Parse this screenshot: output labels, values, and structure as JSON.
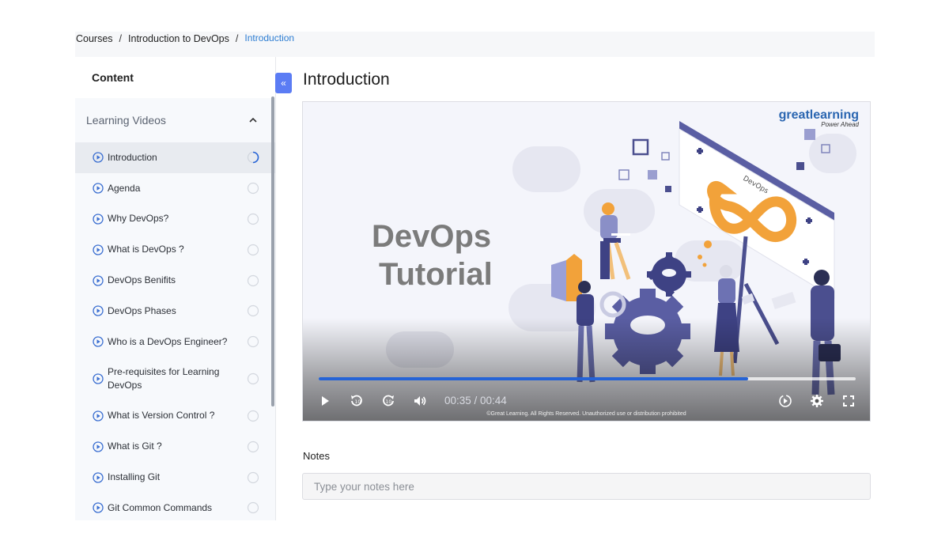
{
  "breadcrumb": {
    "items": [
      "Courses",
      "Introduction to DevOps"
    ],
    "separator": "/",
    "current": "Introduction"
  },
  "sidebar": {
    "title": "Content",
    "collapse_label": "«",
    "section": {
      "label": "Learning Videos",
      "expanded": true
    },
    "items": [
      {
        "label": "Introduction",
        "active": true,
        "status": "in-progress"
      },
      {
        "label": "Agenda",
        "status": "not-started"
      },
      {
        "label": "Why DevOps?",
        "status": "not-started"
      },
      {
        "label": "What is DevOps ?",
        "status": "not-started"
      },
      {
        "label": "DevOps Benifits",
        "status": "not-started"
      },
      {
        "label": "DevOps Phases",
        "status": "not-started"
      },
      {
        "label": "Who is a DevOps Engineer?",
        "status": "not-started"
      },
      {
        "label": "Pre-requisites for Learning DevOps",
        "status": "not-started"
      },
      {
        "label": "What is Version Control ?",
        "status": "not-started"
      },
      {
        "label": "What is Git ?",
        "status": "not-started"
      },
      {
        "label": "Installing Git",
        "status": "not-started"
      },
      {
        "label": "Git Common Commands",
        "status": "not-started"
      }
    ]
  },
  "main": {
    "title": "Introduction",
    "video": {
      "slide_line1": "DevOps",
      "slide_line2": "Tutorial",
      "brand_name": "greatlearning",
      "brand_tagline": "Power Ahead",
      "time": "00:35 / 00:44",
      "progress_fraction": 0.8,
      "copyright": "©Great Learning. All Rights Reserved. Unauthorized use or distribution prohibited"
    },
    "notes": {
      "label": "Notes",
      "placeholder": "Type your notes here"
    }
  },
  "colors": {
    "accent": "#2563d6",
    "breadcrumb_current": "#2d7dd2",
    "collapse_button": "#5b7cf4"
  }
}
